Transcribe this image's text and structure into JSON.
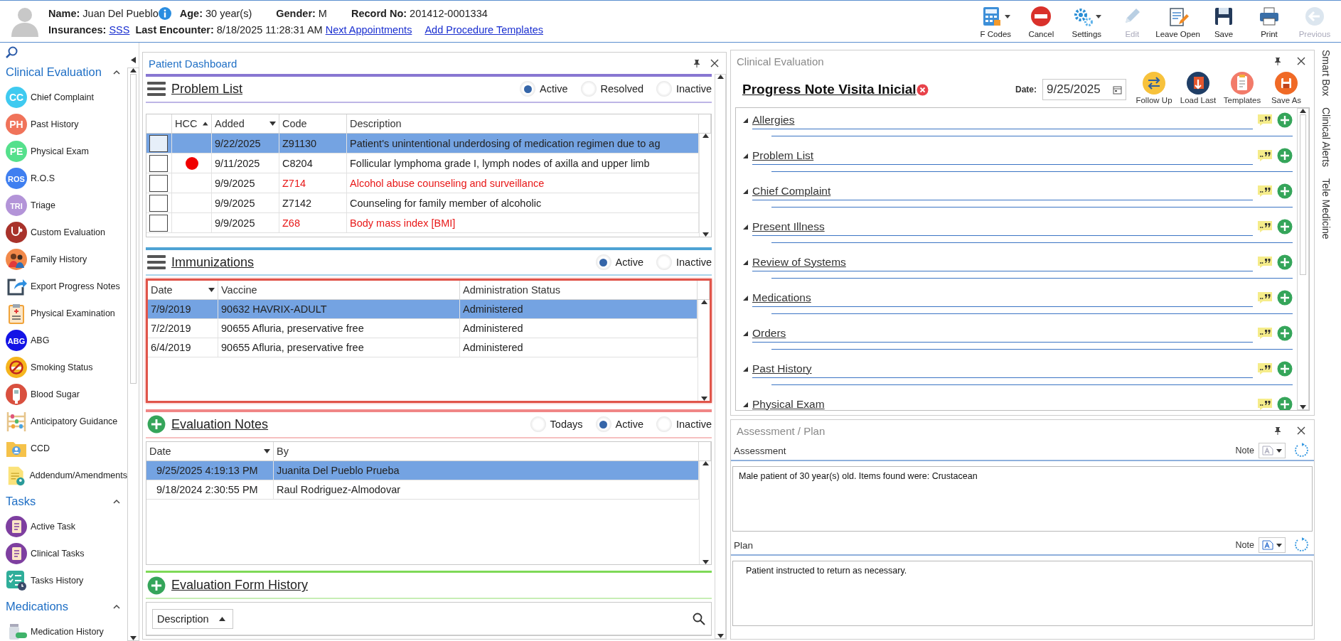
{
  "header": {
    "name_label": "Name:",
    "name": "Juan Del Pueblo",
    "age_label": "Age:",
    "age": "30 year(s)",
    "gender_label": "Gender:",
    "gender": "M",
    "record_label": "Record No:",
    "record": "201412-0001334",
    "insurances_label": "Insurances:",
    "insurance": "SSS",
    "last_encounter_label": "Last Encounter:",
    "last_encounter": "8/18/2025 11:28:31 AM",
    "links": [
      "Next Appointments",
      "Add Procedure Templates"
    ]
  },
  "toolbar": [
    {
      "label": "F Codes",
      "kind": "calculator",
      "dropdown": true,
      "disabled": false
    },
    {
      "label": "Cancel",
      "kind": "stop",
      "dropdown": false,
      "disabled": false
    },
    {
      "label": "Settings",
      "kind": "gears",
      "dropdown": true,
      "disabled": false
    },
    {
      "label": "Edit",
      "kind": "pencil",
      "dropdown": false,
      "disabled": true
    },
    {
      "label": "Leave Open",
      "kind": "notepad",
      "dropdown": false,
      "disabled": false
    },
    {
      "label": "Save",
      "kind": "floppy",
      "dropdown": false,
      "disabled": false
    },
    {
      "label": "Print",
      "kind": "printer",
      "dropdown": false,
      "disabled": false
    },
    {
      "label": "Previous",
      "kind": "back",
      "dropdown": false,
      "disabled": true
    }
  ],
  "sidebar": {
    "groups": [
      {
        "title": "Clinical Evaluation",
        "expanded": true,
        "items": [
          {
            "label": "Chief Complaint",
            "kind": "badge",
            "badge": "CC",
            "color": "#3fcaf0"
          },
          {
            "label": "Past History",
            "kind": "badge",
            "badge": "PH",
            "color": "#f0735a"
          },
          {
            "label": "Physical Exam",
            "kind": "badge",
            "badge": "PE",
            "color": "#55e08c"
          },
          {
            "label": "R.O.S",
            "kind": "badge",
            "badge": "ROS",
            "color": "#3f7ff0"
          },
          {
            "label": "Triage",
            "kind": "badge",
            "badge": "TRI",
            "color": "#b394d8"
          },
          {
            "label": "Custom Evaluation",
            "kind": "stethoscope"
          },
          {
            "label": "Family History",
            "kind": "family"
          },
          {
            "label": "Export Progress Notes",
            "kind": "export"
          },
          {
            "label": "Physical Examination",
            "kind": "clipboard"
          },
          {
            "label": "ABG",
            "kind": "badge",
            "badge": "ABG",
            "color": "#1414e6"
          },
          {
            "label": "Smoking Status",
            "kind": "smoking"
          },
          {
            "label": "Blood Sugar",
            "kind": "glucometer"
          },
          {
            "label": "Anticipatory Guidance",
            "kind": "abacus"
          },
          {
            "label": "CCD",
            "kind": "folder"
          },
          {
            "label": "Addendum/Amendments",
            "kind": "document"
          }
        ]
      },
      {
        "title": "Tasks",
        "expanded": true,
        "items": [
          {
            "label": "Active Task",
            "kind": "task"
          },
          {
            "label": "Clinical Tasks",
            "kind": "task"
          },
          {
            "label": "Tasks History",
            "kind": "checklist"
          }
        ]
      },
      {
        "title": "Medications",
        "expanded": true,
        "items": [
          {
            "label": "Medication History",
            "kind": "pills"
          }
        ]
      }
    ]
  },
  "dashboard": {
    "title": "Patient Dashboard",
    "problem_list": {
      "title": "Problem List",
      "filters": [
        {
          "label": "Active",
          "selected": true
        },
        {
          "label": "Resolved",
          "selected": false
        },
        {
          "label": "Inactive",
          "selected": false
        }
      ],
      "columns": [
        {
          "label": "HCC",
          "ascending": true
        },
        {
          "label": "Added",
          "ascending": false
        },
        {
          "label": "Code"
        },
        {
          "label": "Description"
        }
      ],
      "rows": [
        {
          "selected": true,
          "checked": false,
          "hcc": false,
          "flagged": false,
          "added": "9/22/2025",
          "code": "Z91130",
          "description": "Patient's unintentional underdosing of medication regimen due to ag"
        },
        {
          "selected": false,
          "checked": false,
          "hcc": true,
          "flagged": false,
          "added": "9/11/2025",
          "code": "C8204",
          "description": "Follicular lymphoma grade I, lymph nodes of axilla and upper limb"
        },
        {
          "selected": false,
          "checked": false,
          "hcc": false,
          "flagged": true,
          "added": "9/9/2025",
          "code": "Z714",
          "description": "Alcohol abuse counseling and surveillance"
        },
        {
          "selected": false,
          "checked": false,
          "hcc": false,
          "flagged": false,
          "added": "9/9/2025",
          "code": "Z7142",
          "description": "Counseling for family member of alcoholic"
        },
        {
          "selected": false,
          "checked": false,
          "hcc": false,
          "flagged": true,
          "added": "9/9/2025",
          "code": "Z68",
          "description": "Body mass index [BMI]"
        }
      ]
    },
    "immunizations": {
      "title": "Immunizations",
      "filters": [
        {
          "label": "Active",
          "selected": true
        },
        {
          "label": "Inactive",
          "selected": false
        }
      ],
      "columns": [
        {
          "label": "Date",
          "ascending": false
        },
        {
          "label": "Vaccine"
        },
        {
          "label": "Administration Status"
        }
      ],
      "rows": [
        {
          "selected": true,
          "date": "7/9/2019",
          "vaccine": "90632 HAVRIX-ADULT",
          "status": "Administered"
        },
        {
          "selected": false,
          "date": "7/2/2019",
          "vaccine": "90655 Afluria, preservative free",
          "status": "Administered"
        },
        {
          "selected": false,
          "date": "6/4/2019",
          "vaccine": "90655 Afluria, preservative free",
          "status": "Administered"
        }
      ]
    },
    "evaluation_notes": {
      "title": "Evaluation Notes",
      "filters": [
        {
          "label": "Todays",
          "selected": false
        },
        {
          "label": "Active",
          "selected": true
        },
        {
          "label": "Inactive",
          "selected": false
        }
      ],
      "columns": [
        {
          "label": "Date",
          "ascending": false
        },
        {
          "label": "By"
        }
      ],
      "rows": [
        {
          "selected": true,
          "date": "9/25/2025 4:19:13 PM",
          "by": "Juanita Del Pueblo Prueba"
        },
        {
          "selected": false,
          "date": "9/18/2024 2:30:55 PM",
          "by": "Raul Rodriguez-Almodovar"
        }
      ]
    },
    "form_history": {
      "title": "Evaluation Form History",
      "column": {
        "label": "Description",
        "ascending": true
      }
    }
  },
  "clinical_evaluation": {
    "title": "Clinical Evaluation",
    "note_title": "Progress Note Visita Inicial",
    "date_label": "Date:",
    "date": "9/25/2025",
    "actions": [
      {
        "label": "Follow Up",
        "kind": "swap"
      },
      {
        "label": "Load Last",
        "kind": "load"
      },
      {
        "label": "Templates",
        "kind": "template"
      },
      {
        "label": "Save As",
        "kind": "saveas"
      }
    ],
    "sections": [
      "Allergies",
      "Problem List",
      "Chief Complaint",
      "Present Illness",
      "Review of Systems",
      "Medications",
      "Orders",
      "Past History",
      "Physical Exam"
    ]
  },
  "assessment_plan": {
    "title": "Assessment / Plan",
    "blocks": [
      {
        "label": "Assessment",
        "note_label": "Note",
        "note_disabled": true,
        "text": "Male patient of 30 year(s) old. Items found were:  Crustacean"
      },
      {
        "label": "Plan",
        "note_label": "Note",
        "note_disabled": false,
        "text": "Patient instructed to return as necessary."
      }
    ]
  },
  "side_tabs": [
    "Smart Box",
    "Clinical Alerts",
    "Tele Medicine"
  ]
}
